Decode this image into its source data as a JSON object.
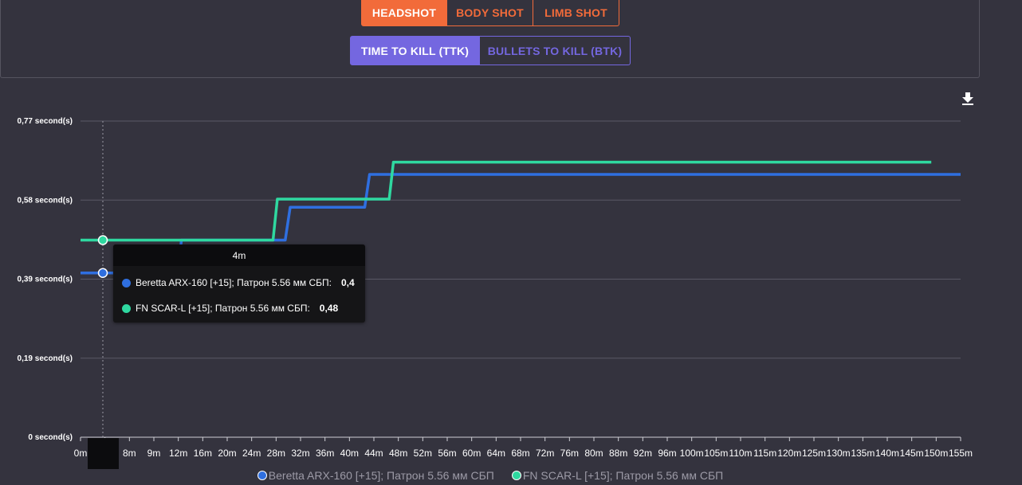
{
  "hit_tabs": [
    {
      "label": "HEADSHOT",
      "active": true
    },
    {
      "label": "BODY SHOT",
      "active": false
    },
    {
      "label": "LIMB SHOT",
      "active": false
    }
  ],
  "mode_tabs": [
    {
      "label": "TIME TO KILL (TTK)",
      "active": true
    },
    {
      "label": "BULLETS TO KILL (BTK)",
      "active": false
    }
  ],
  "download_icon": "download-icon",
  "colors": {
    "accent_orange": "#f26b3a",
    "accent_purple": "#7467e0",
    "series1": "#2f6fe0",
    "series2": "#2fd8a0"
  },
  "chart_data": {
    "type": "line",
    "y_ticks": [
      "0 second(s)",
      "0,19 second(s)",
      "0,39 second(s)",
      "0,58 second(s)",
      "0,77 second(s)"
    ],
    "ylim": [
      0,
      0.77
    ],
    "x_ticks": [
      "0m",
      "4m",
      "8m",
      "9m",
      "12m",
      "16m",
      "20m",
      "24m",
      "28m",
      "32m",
      "36m",
      "40m",
      "44m",
      "48m",
      "52m",
      "56m",
      "60m",
      "64m",
      "68m",
      "72m",
      "76m",
      "80m",
      "88m",
      "92m",
      "96m",
      "100m",
      "105m",
      "110m",
      "115m",
      "120m",
      "125m",
      "130m",
      "135m",
      "140m",
      "145m",
      "150m",
      "155m"
    ],
    "series": [
      {
        "name": "Beretta ARX-160 [+15]; Патрон 5.56 мм СБП",
        "color": "#2f6fe0",
        "steps": [
          [
            0,
            0.4
          ],
          [
            12,
            0.4
          ],
          [
            12.5,
            0.48
          ],
          [
            29.5,
            0.48
          ],
          [
            30.3,
            0.56
          ],
          [
            42.5,
            0.56
          ],
          [
            43.3,
            0.64
          ],
          [
            155,
            0.64
          ]
        ]
      },
      {
        "name": "FN SCAR-L [+15]; Патрон 5.56 мм СБП",
        "color": "#2fd8a0",
        "steps": [
          [
            0,
            0.48
          ],
          [
            27.5,
            0.48
          ],
          [
            28.2,
            0.58
          ],
          [
            46.5,
            0.58
          ],
          [
            47.2,
            0.67
          ],
          [
            149,
            0.67
          ]
        ]
      }
    ],
    "grid": true,
    "legend_position": "bottom",
    "tooltip": {
      "title": "4m",
      "rows": [
        {
          "label": "Beretta ARX-160 [+15]; Патрон 5.56 мм СБП:",
          "value": "0,4"
        },
        {
          "label": "FN SCAR-L [+15]; Патрон 5.56 мм СБП:",
          "value": "0,48"
        }
      ]
    },
    "hover_x": 4
  }
}
